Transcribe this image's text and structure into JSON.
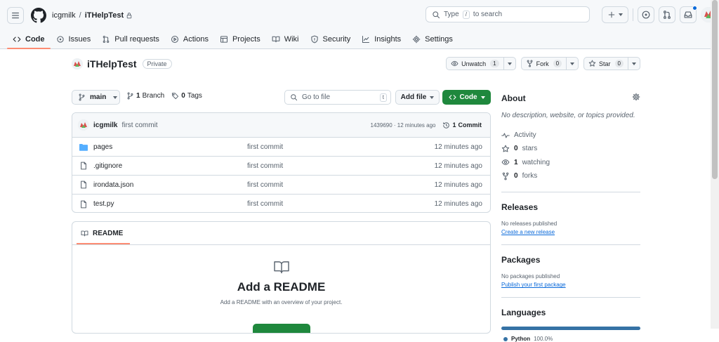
{
  "header": {
    "owner": "icgmilk",
    "separator": "/",
    "repo": "iTHelpTest",
    "search_placeholder_pre": "Type",
    "search_key": "/",
    "search_placeholder_post": "to search"
  },
  "tabs": [
    {
      "label": "Code",
      "icon": "code-icon"
    },
    {
      "label": "Issues",
      "icon": "issue-icon"
    },
    {
      "label": "Pull requests",
      "icon": "pull-request-icon"
    },
    {
      "label": "Actions",
      "icon": "play-icon"
    },
    {
      "label": "Projects",
      "icon": "table-icon"
    },
    {
      "label": "Wiki",
      "icon": "book-icon"
    },
    {
      "label": "Security",
      "icon": "shield-icon"
    },
    {
      "label": "Insights",
      "icon": "graph-icon"
    },
    {
      "label": "Settings",
      "icon": "gear-icon"
    }
  ],
  "repo": {
    "name": "iTHelpTest",
    "visibility": "Private",
    "unwatch_label": "Unwatch",
    "unwatch_count": "1",
    "fork_label": "Fork",
    "fork_count": "0",
    "star_label": "Star",
    "star_count": "0"
  },
  "filenav": {
    "branch": "main",
    "branches_count": "1",
    "branches_label": "Branch",
    "tags_count": "0",
    "tags_label": "Tags",
    "goto_placeholder": "Go to file",
    "goto_key": "t",
    "add_file_label": "Add file",
    "code_label": "Code"
  },
  "commit": {
    "author": "icgmilk",
    "message": "first commit",
    "hash_time": "1439690 · 12 minutes ago",
    "commits_count": "1",
    "commits_label": "Commit"
  },
  "files": [
    {
      "name": "pages",
      "type": "folder",
      "message": "first commit",
      "time": "12 minutes ago"
    },
    {
      "name": ".gitignore",
      "type": "file",
      "message": "first commit",
      "time": "12 minutes ago"
    },
    {
      "name": "irondata.json",
      "type": "file",
      "message": "first commit",
      "time": "12 minutes ago"
    },
    {
      "name": "test.py",
      "type": "file",
      "message": "first commit",
      "time": "12 minutes ago"
    }
  ],
  "readme": {
    "tab_label": "README",
    "title": "Add a README",
    "subtitle": "Add a README with an overview of your project."
  },
  "sidebar": {
    "about_title": "About",
    "description": "No description, website, or topics provided.",
    "activity": "Activity",
    "stars_count": "0",
    "stars_label": "stars",
    "watching_count": "1",
    "watching_label": "watching",
    "forks_count": "0",
    "forks_label": "forks",
    "releases_title": "Releases",
    "releases_empty": "No releases published",
    "releases_link": "Create a new release",
    "packages_title": "Packages",
    "packages_empty": "No packages published",
    "packages_link": "Publish your first package",
    "languages_title": "Languages",
    "language_name": "Python",
    "language_percent": "100.0%",
    "language_color": "#3572a5"
  }
}
